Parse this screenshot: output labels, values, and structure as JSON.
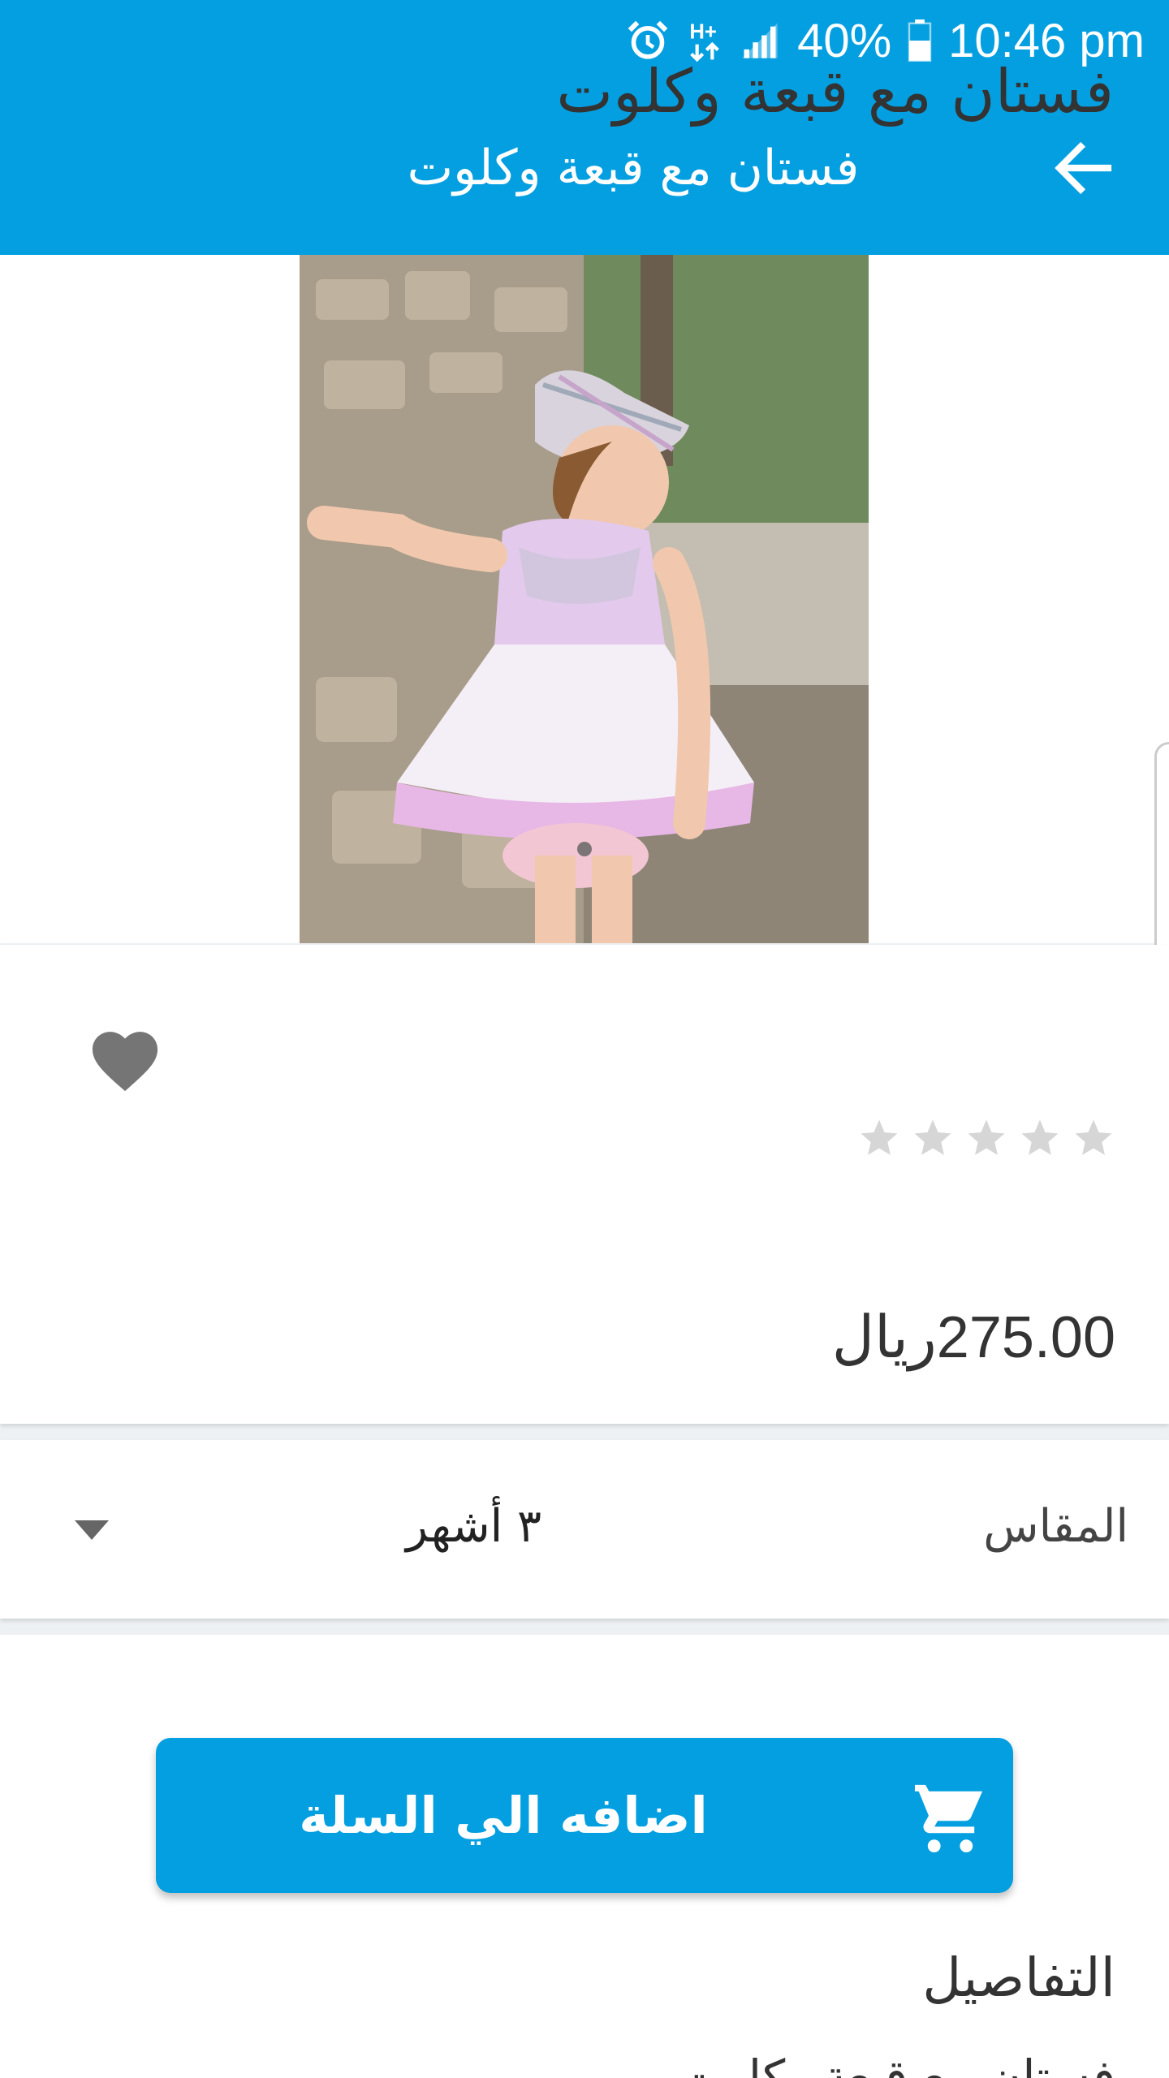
{
  "status_bar": {
    "battery": "40%",
    "time": "10:46 pm",
    "icons": [
      "alarm-icon",
      "data-h-plus-icon",
      "signal-icon",
      "battery-icon"
    ]
  },
  "app_bar": {
    "title": "فستان مع قبعة وكلوت",
    "back_icon": "arrow-back-icon"
  },
  "gallery": {
    "page_count": 1,
    "current_page": 1
  },
  "product": {
    "title": "فستان مع قبعة وكلوت",
    "rating": 0,
    "max_rating": 5,
    "price": "275.00ريال",
    "favorite_icon": "heart-icon"
  },
  "size": {
    "label": "المقاس",
    "selected": "٣ أشهر"
  },
  "cart": {
    "button_label": "اضافه الي السلة",
    "icon": "cart-icon"
  },
  "details": {
    "heading": "التفاصيل",
    "text": "فستان مع قبعة وكلوت"
  },
  "colors": {
    "primary": "#049fe0",
    "star_empty": "#d6d6d6",
    "heart": "#757575"
  }
}
